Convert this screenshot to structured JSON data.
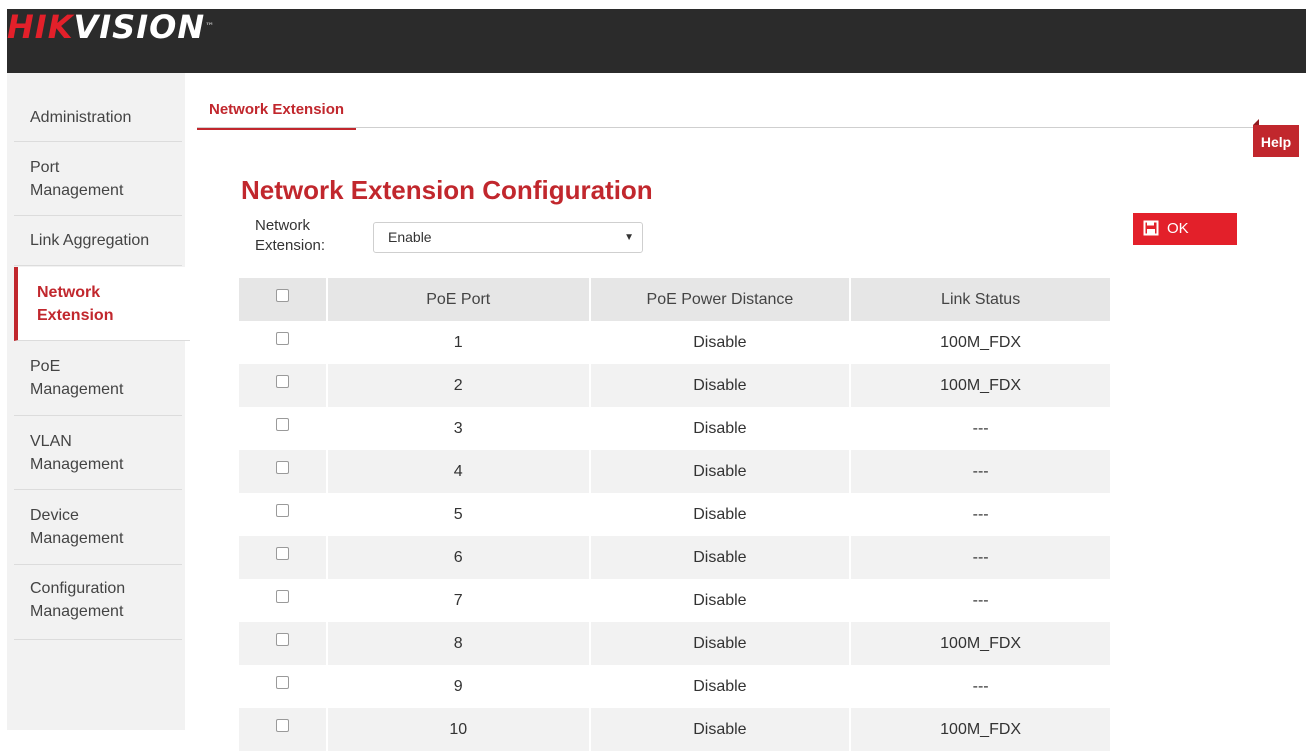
{
  "header": {
    "logo_part1": "HIK",
    "logo_part2": "VISION",
    "logo_tm": "™"
  },
  "sidebar": {
    "items": [
      {
        "label": "Administration"
      },
      {
        "label": "Port Management"
      },
      {
        "label": "Link Aggregation"
      },
      {
        "label": "Network Extension"
      },
      {
        "label": "PoE Management"
      },
      {
        "label": "VLAN Management"
      },
      {
        "label": "Device Management"
      },
      {
        "label": "Configuration Management"
      }
    ],
    "active_index": 3
  },
  "tab": {
    "label": "Network Extension"
  },
  "help": {
    "label": "Help"
  },
  "main": {
    "title": "Network Extension Configuration",
    "network_extension_label": "Network Extension:",
    "network_extension_value": "Enable",
    "ok_label": "OK"
  },
  "table": {
    "headers": [
      "PoE Port",
      "PoE Power Distance",
      "Link Status"
    ],
    "rows": [
      {
        "port": "1",
        "distance": "Disable",
        "status": "100M_FDX"
      },
      {
        "port": "2",
        "distance": "Disable",
        "status": "100M_FDX"
      },
      {
        "port": "3",
        "distance": "Disable",
        "status": "---"
      },
      {
        "port": "4",
        "distance": "Disable",
        "status": "---"
      },
      {
        "port": "5",
        "distance": "Disable",
        "status": "---"
      },
      {
        "port": "6",
        "distance": "Disable",
        "status": "---"
      },
      {
        "port": "7",
        "distance": "Disable",
        "status": "---"
      },
      {
        "port": "8",
        "distance": "Disable",
        "status": "100M_FDX"
      },
      {
        "port": "9",
        "distance": "Disable",
        "status": "---"
      },
      {
        "port": "10",
        "distance": "Disable",
        "status": "100M_FDX"
      }
    ]
  },
  "colors": {
    "accent": "#c1272d",
    "ok_button": "#e3202a",
    "header_bg": "#2b2b2b",
    "sidebar_bg": "#f2f2f2"
  },
  "icons": {
    "ok": "save-icon",
    "select": "dropdown-arrow-icon"
  }
}
